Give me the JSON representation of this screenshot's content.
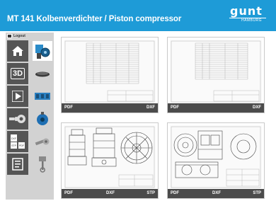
{
  "header": {
    "title": "MT 141 Kolbenverdichter / Piston compressor"
  },
  "logo": {
    "word": "gunt",
    "sub": "HAMBURG"
  },
  "sidebar": {
    "logout_label": "Logout",
    "buttons": [
      {
        "name": "home",
        "icon": "home-icon",
        "active": false
      },
      {
        "name": "3d",
        "label": "3D",
        "icon": "3d-icon",
        "active": false
      },
      {
        "name": "video",
        "icon": "play-icon",
        "active": false
      },
      {
        "name": "parts",
        "icon": "parts-icon",
        "active": false
      },
      {
        "name": "formats",
        "labels": [
          "DXF",
          "STP",
          "PDF"
        ],
        "icon": "file-formats-icon",
        "active": false
      },
      {
        "name": "documents",
        "icon": "document-icon",
        "active": false
      }
    ],
    "thumbs": [
      "compressor-thumb",
      "gasket-thumb",
      "cylinder-thumb",
      "fan-thumb",
      "valve-thumb",
      "piston-thumb"
    ]
  },
  "cards": [
    {
      "formats": [
        "PDF",
        "DXF"
      ],
      "kind": "parts-list"
    },
    {
      "formats": [
        "PDF",
        "DXF"
      ],
      "kind": "parts-list"
    },
    {
      "formats": [
        "PDF",
        "DXF",
        "STP"
      ],
      "kind": "assembly-drawing"
    },
    {
      "formats": [
        "PDF",
        "DXF",
        "STP"
      ],
      "kind": "assembly-drawing"
    }
  ]
}
